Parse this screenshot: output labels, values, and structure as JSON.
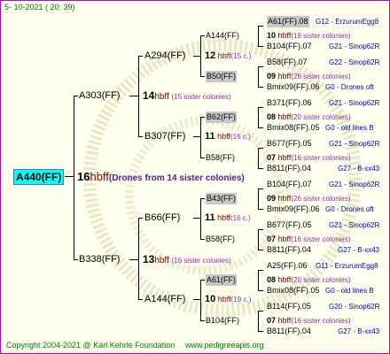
{
  "date": "5- 10-2021 ( 20: 39)",
  "root": {
    "name": "A440(FF)",
    "num": "16",
    "hb": "hbff",
    "note": "(Drones from 14 sister colonies)"
  },
  "gen1": [
    {
      "name": "A303(FF)",
      "num": "14",
      "hb": "hbff",
      "note": "(15 sister colonies)"
    },
    {
      "name": "B338(FF)",
      "num": "13",
      "hb": "hbff",
      "note": "(16 sister colonies)"
    }
  ],
  "gen2": [
    {
      "name": "A294(FF)",
      "num": "12",
      "hb": "hbff",
      "note": "(15 c.)"
    },
    {
      "name": "B307(FF)",
      "num": "11",
      "hb": "hbff",
      "note": "(16 c.)"
    },
    {
      "name": "B66(FF)",
      "num": "11",
      "hb": "hbff",
      "note": "(16 c.)"
    },
    {
      "name": "A144(FF)",
      "num": "10",
      "hb": "hbff",
      "note": "(19 c.)"
    }
  ],
  "gen3": [
    {
      "name": "A144(FF)",
      "num": "10",
      "hb": "hbff",
      "note": "(19 sister colonies)"
    },
    {
      "name": "B50(FF)",
      "num": "09",
      "hb": "hbff",
      "note": "(26 sister colonies)"
    },
    {
      "name": "B62(FF)",
      "num": "08",
      "hb": "hbff",
      "note": "(20 sister colonies)"
    },
    {
      "name": "B58(FF)",
      "num": "07",
      "hb": "hbff",
      "note": "(16 sister colonies)"
    },
    {
      "name": "B43(FF)",
      "num": "09",
      "hb": "hbff",
      "note": "(26 sister colonies)"
    },
    {
      "name": "B58(FF)",
      "num": "07",
      "hb": "hbff",
      "note": "(16 sister colonies)"
    },
    {
      "name": "A61(FF)",
      "num": "08",
      "hb": "hbff",
      "note": "(20 sister colonies)"
    },
    {
      "name": "B104(FF)",
      "num": "07",
      "hb": "hbff",
      "note": "(16 sister colonies)"
    }
  ],
  "gen4": [
    {
      "name": "A61(FF).08",
      "note": "G12 - ErzurumEgg8"
    },
    {
      "name": "B104(FF).07",
      "note": "G21 - Sinop62R"
    },
    {
      "name": "B58(FF).07",
      "note": "G22 - Sinop62R"
    },
    {
      "name": "Bmix09(FF).06",
      "note": "G0 - Drones oft"
    },
    {
      "name": "B371(FF).06",
      "note": "G21 - Sinop62R"
    },
    {
      "name": "Bmix08(FF).05",
      "note": "G0 - old lines B"
    },
    {
      "name": "B677(FF).05",
      "note": "G21 - Sinop62R"
    },
    {
      "name": "B811(FF).04",
      "note": "G27 - B-xx43"
    },
    {
      "name": "B104(FF).07",
      "note": "G21 - Sinop62R"
    },
    {
      "name": "Bmix09(FF).06",
      "note": "G0 - Drones oft"
    },
    {
      "name": "B677(FF).05",
      "note": "G21 - Sinop62R"
    },
    {
      "name": "B811(FF).04",
      "note": "G27 - B-xx43"
    },
    {
      "name": "A25(FF).06",
      "note": "G11 - ErzurumEgg8"
    },
    {
      "name": "Bmix08(FF).05",
      "note": "G0 - old lines B"
    },
    {
      "name": "B114(FF).05",
      "note": "G20 - Sinop62R"
    },
    {
      "name": "B811(FF).04",
      "note": "G27 - B-xx43"
    }
  ],
  "footer": {
    "copyright": "Copyright 2004-2021 @ Karl Kehrle Foundation",
    "site": "www.pedigreeapis.org"
  }
}
